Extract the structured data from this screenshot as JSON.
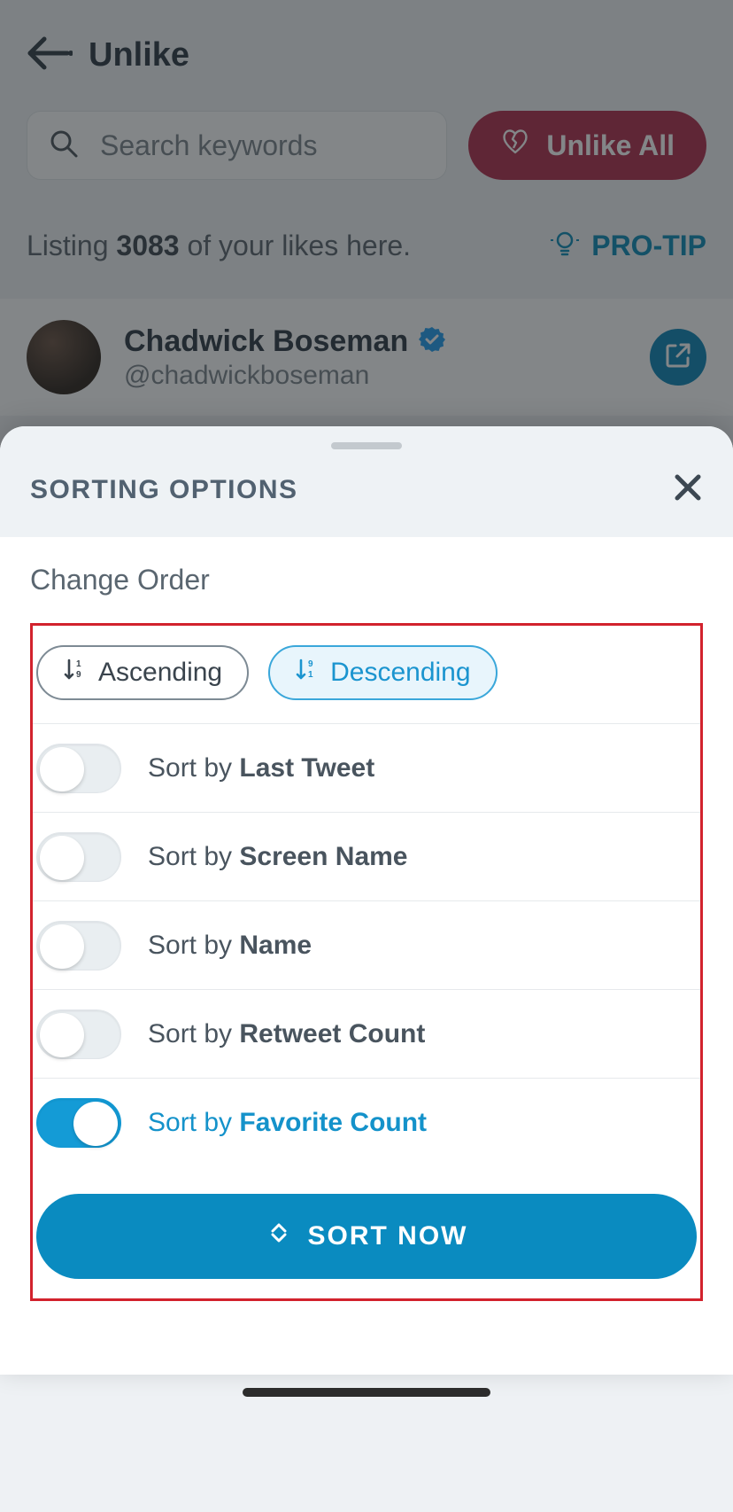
{
  "header": {
    "title": "Unlike"
  },
  "search": {
    "placeholder": "Search keywords"
  },
  "unlike_all": {
    "label": "Unlike All"
  },
  "listing": {
    "prefix": "Listing ",
    "count": "3083",
    "suffix": " of your likes here."
  },
  "protip": {
    "label": "PRO-TIP"
  },
  "tweet": {
    "name": "Chadwick Boseman",
    "handle": "@chadwickboseman"
  },
  "sheet": {
    "title": "SORTING OPTIONS",
    "change_order": "Change Order",
    "ascending": "Ascending",
    "descending": "Descending",
    "sort_by": "Sort by ",
    "options": [
      {
        "label": "Last Tweet",
        "on": false
      },
      {
        "label": "Screen Name",
        "on": false
      },
      {
        "label": "Name",
        "on": false
      },
      {
        "label": "Retweet Count",
        "on": false
      },
      {
        "label": "Favorite Count",
        "on": true
      }
    ],
    "sort_now": "SORT NOW"
  }
}
